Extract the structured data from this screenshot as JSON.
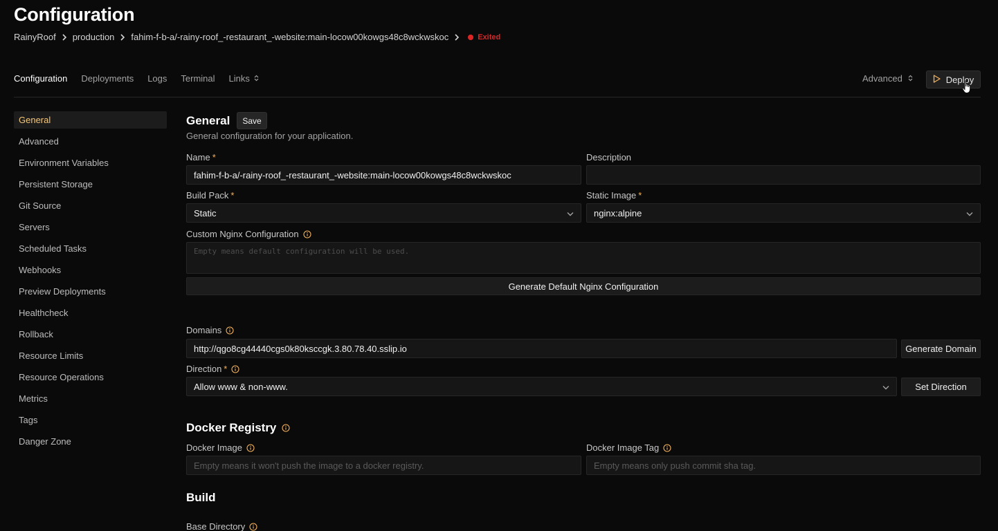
{
  "page": {
    "title": "Configuration"
  },
  "breadcrumb": {
    "items": [
      "RainyRoof",
      "production",
      "fahim-f-b-a/-rainy-roof_-restaurant_-website:main-locow00kowgs48c8wckwskoc"
    ],
    "status": "Exited",
    "status_color": "#dc2626"
  },
  "topnav": {
    "items": [
      "Configuration",
      "Deployments",
      "Logs",
      "Terminal",
      "Links"
    ],
    "advanced": "Advanced",
    "deploy": "Deploy"
  },
  "sidebar": {
    "items": [
      "General",
      "Advanced",
      "Environment Variables",
      "Persistent Storage",
      "Git Source",
      "Servers",
      "Scheduled Tasks",
      "Webhooks",
      "Preview Deployments",
      "Healthcheck",
      "Rollback",
      "Resource Limits",
      "Resource Operations",
      "Metrics",
      "Tags",
      "Danger Zone"
    ]
  },
  "general": {
    "title": "General",
    "save": "Save",
    "subtitle": "General configuration for your application.",
    "name_label": "Name",
    "name_value": "fahim-f-b-a/-rainy-roof_-restaurant_-website:main-locow00kowgs48c8wckwskoc",
    "description_label": "Description",
    "description_value": "",
    "build_pack_label": "Build Pack",
    "build_pack_value": "Static",
    "static_image_label": "Static Image",
    "static_image_value": "nginx:alpine",
    "nginx_label": "Custom Nginx Configuration",
    "nginx_placeholder": "Empty means default configuration will be used.",
    "generate_nginx": "Generate Default Nginx Configuration",
    "domains_label": "Domains",
    "domains_value": "http://qgo8cg44440cgs0k80ksccgk.3.80.78.40.sslip.io",
    "generate_domain": "Generate Domain",
    "direction_label": "Direction",
    "direction_value": "Allow www & non-www.",
    "set_direction": "Set Direction",
    "required_mark": "*"
  },
  "docker_registry": {
    "title": "Docker Registry",
    "image_label": "Docker Image",
    "image_placeholder": "Empty means it won't push the image to a docker registry.",
    "tag_label": "Docker Image Tag",
    "tag_placeholder": "Empty means only push commit sha tag."
  },
  "build": {
    "title": "Build",
    "base_dir_label": "Base Directory"
  },
  "colors": {
    "accent": "#f5c77a",
    "required": "#f5b25c",
    "status": "#dc2626"
  }
}
